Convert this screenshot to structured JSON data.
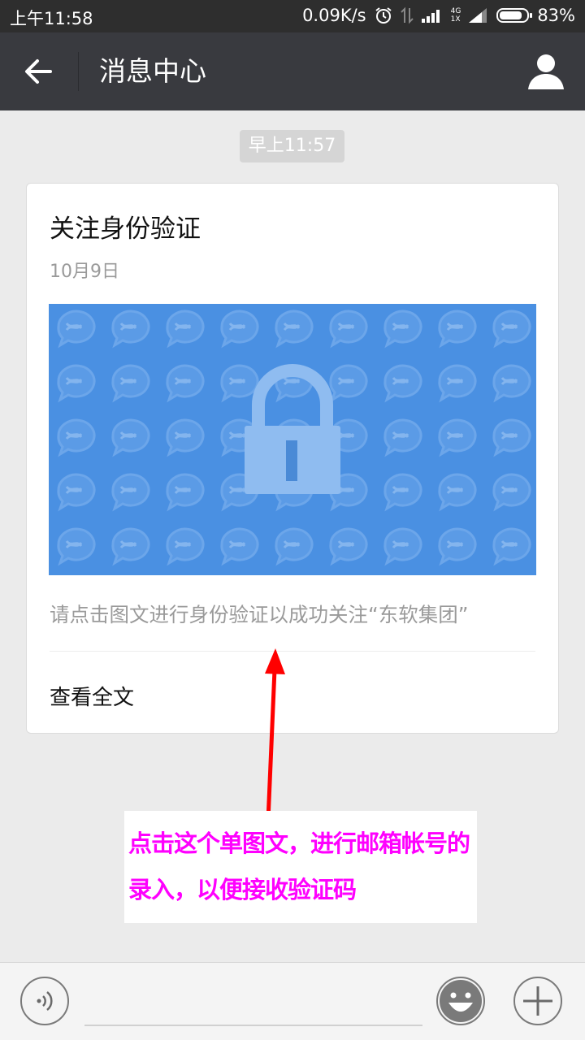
{
  "status_bar": {
    "time": "上午11:58",
    "speed": "0.09K/s",
    "network": "4G",
    "sim": "1X",
    "battery": "83%",
    "battery_level": 0.83
  },
  "nav": {
    "title": "消息中心"
  },
  "timestamp": "早上11:57",
  "article": {
    "title": "关注身份验证",
    "date": "10月9日",
    "description": "请点击图文进行身份验证以成功关注“东软集团”",
    "read_more": "查看全文"
  },
  "annotation": {
    "text": "点击这个单图文，进行邮箱帐号的录入，以便接收验证码",
    "color": "#ff00ff"
  },
  "colors": {
    "nav_bg": "#393a3f",
    "image_bg": "#4a90e2",
    "page_bg": "#ebebeb"
  }
}
